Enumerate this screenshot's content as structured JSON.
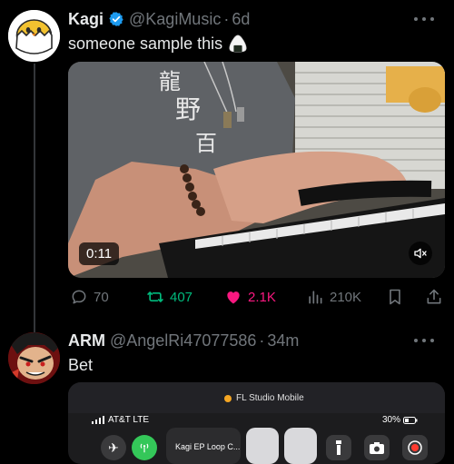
{
  "colors": {
    "background": "#000000",
    "text": "#e7e9ea",
    "muted": "#71767b",
    "verified": "#1d9bf0",
    "retweet": "#00ba7c",
    "like": "#f91880"
  },
  "post1": {
    "name": "Kagi",
    "handle": "@KagiMusic",
    "separator": "·",
    "time": "6d",
    "text": "someone sample this",
    "emoji": "rice-ball-icon",
    "video_timer": "0:11",
    "video_muted": true,
    "replies": "70",
    "retweets": "407",
    "likes": "2.1K",
    "views": "210K",
    "liked": true,
    "retweeted": true
  },
  "post2": {
    "name": "ARM",
    "handle": "@AngelRi47077586",
    "separator": "·",
    "time": "34m",
    "text": "Bet",
    "screenshot": {
      "app_title": "FL Studio Mobile",
      "carrier": "AT&T LTE",
      "battery": "30%",
      "now_playing": "Kagi EP Loop C..."
    }
  }
}
